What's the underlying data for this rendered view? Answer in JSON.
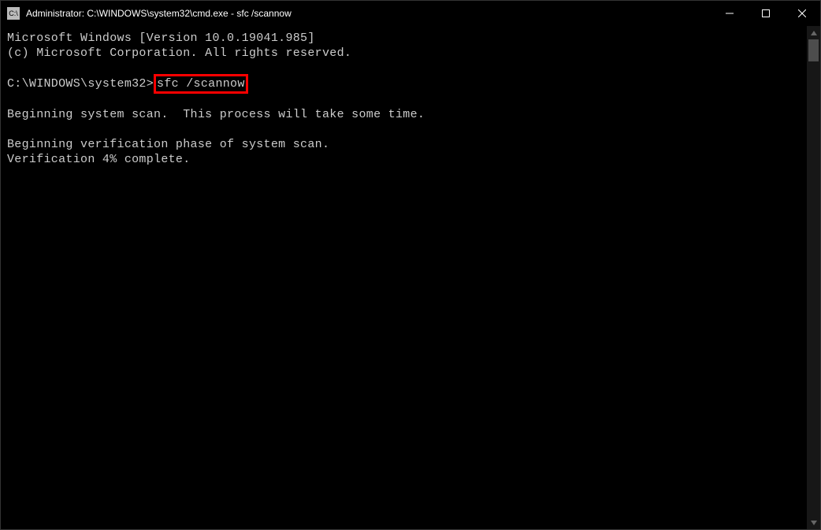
{
  "window": {
    "title": "Administrator: C:\\WINDOWS\\system32\\cmd.exe - sfc  /scannow"
  },
  "terminal": {
    "line1": "Microsoft Windows [Version 10.0.19041.985]",
    "line2": "(c) Microsoft Corporation. All rights reserved.",
    "prompt": "C:\\WINDOWS\\system32>",
    "command": "sfc /scannow",
    "line_scan": "Beginning system scan.  This process will take some time.",
    "line_verify": "Beginning verification phase of system scan.",
    "line_progress": "Verification 4% complete."
  }
}
